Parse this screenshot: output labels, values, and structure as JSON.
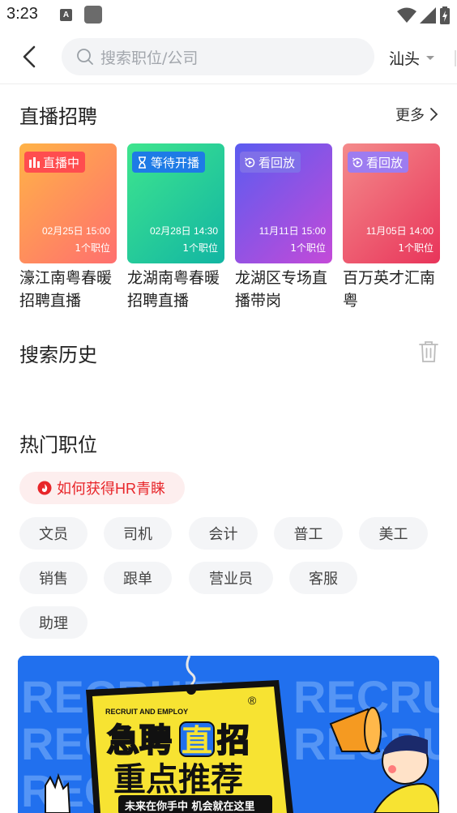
{
  "status_bar": {
    "time": "3:23",
    "a_icon_letter": "A"
  },
  "search": {
    "placeholder": "搜索职位/公司",
    "city": "汕头"
  },
  "live": {
    "title": "直播招聘",
    "more": "更多",
    "cards": [
      {
        "badge": "直播中",
        "badge_icon": "live-bars-icon",
        "date": "02月25日 15:00",
        "jobs": "1个职位",
        "title": "濠江南粤春暖招聘直播",
        "color_from": "#ffb347",
        "color_to": "#ff6f6f",
        "badge_color": "#ff4d4f"
      },
      {
        "badge": "等待开播",
        "badge_icon": "hourglass-icon",
        "date": "02月28日 14:30",
        "jobs": "1个职位",
        "title": "龙湖南粤春暖招聘直播",
        "color_from": "#3ee58e",
        "color_to": "#12b5a3",
        "badge_color": "#1e7be6"
      },
      {
        "badge": "看回放",
        "badge_icon": "replay-icon",
        "date": "11月11日 15:00",
        "jobs": "1个职位",
        "title": "龙湖区专场直播带岗",
        "color_from": "#5b5cf0",
        "color_to": "#c44ad8",
        "badge_color": "#7f6fe8"
      },
      {
        "badge": "看回放",
        "badge_icon": "replay-icon",
        "date": "11月05日 14:00",
        "jobs": "1个职位",
        "title": "百万英才汇南粤",
        "color_from": "#f48b8b",
        "color_to": "#e8345a",
        "badge_color": "#9d7cf0"
      }
    ]
  },
  "history": {
    "title": "搜索历史"
  },
  "hot_jobs": {
    "title": "热门职位",
    "tip": "如何获得HR青睐",
    "tags": [
      "文员",
      "司机",
      "会计",
      "普工",
      "美工",
      "销售",
      "跟单",
      "营业员",
      "客服",
      "助理"
    ]
  },
  "banner": {
    "bg_word": "RECRUIT",
    "top_small": "RECRUIT AND EMPLOY",
    "line1a": "急聘",
    "line1b": "直",
    "line1c": "招",
    "line2": "重点推荐",
    "slogan": "未来在你手中 机会就在这里",
    "reg": "®"
  },
  "colors": {
    "accent": "#e8262a",
    "banner_blue": "#1f6ff0",
    "tag_bg": "#f4f5f7",
    "badge_yellow": "#f7e332"
  }
}
